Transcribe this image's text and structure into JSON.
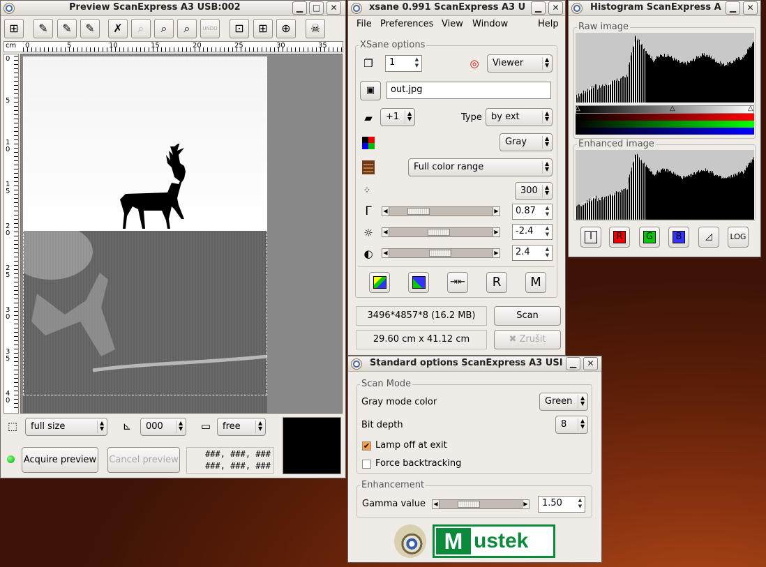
{
  "preview": {
    "title": "Preview ScanExpress A3 USB:002",
    "ruler_unit": "cm",
    "ruler_ticks": [
      "0",
      "5",
      "10",
      "15",
      "20",
      "25",
      "30",
      "35"
    ],
    "vruler_ticks": [
      "0",
      "5",
      "1\n0",
      "1\n5",
      "2\n0",
      "2\n5",
      "3\n0",
      "3\n5",
      "4\n0"
    ],
    "size_combo": "full size",
    "rotation_combo": "000",
    "ratio_combo": "free",
    "acquire_label": "Acquire preview",
    "cancel_label": "Cancel preview",
    "coords_line1": "###, ###, ###",
    "coords_line2": "###, ###, ###"
  },
  "xsane": {
    "title": "xsane 0.991 ScanExpress A3 U",
    "menu": [
      "File",
      "Preferences",
      "View",
      "Window",
      "Help"
    ],
    "group_label": "XSane options",
    "copies_value": "1",
    "target_combo": "Viewer",
    "filename_value": "out.jpg",
    "step_value": "+1",
    "type_label": "Type",
    "type_combo": "by ext",
    "color_combo": "Gray",
    "range_combo": "Full color range",
    "resolution_value": "300",
    "gamma_value": "0.87",
    "brightness_value": "-2.4",
    "contrast_value": "2.4",
    "info_size": "3496*4857*8 (16.2 MB)",
    "info_dims": "29.60 cm x 41.12 cm",
    "scan_label": "Scan",
    "cancel_label": "Zrušit"
  },
  "histogram": {
    "title": "Histogram ScanExpress A",
    "raw_label": "Raw image",
    "enhanced_label": "Enhanced image",
    "buttons": [
      "I",
      "R",
      "G",
      "B",
      "LOG"
    ],
    "colors": {
      "red": "#e00000",
      "green": "#00c000",
      "blue": "#0000e0"
    }
  },
  "standard": {
    "title": "Standard options ScanExpress A3 USI",
    "scan_mode_label": "Scan Mode",
    "gray_mode_label": "Gray mode color",
    "gray_mode_value": "Green",
    "bit_depth_label": "Bit depth",
    "bit_depth_value": "8",
    "lamp_off_label": "Lamp off at exit",
    "lamp_off_checked": true,
    "backtrack_label": "Force backtracking",
    "backtrack_checked": false,
    "enhancement_label": "Enhancement",
    "gamma_label": "Gamma value",
    "gamma_value": "1.50",
    "brand_logo_text": "Mustek",
    "brand_colors": {
      "green": "#0a8a3a"
    }
  }
}
